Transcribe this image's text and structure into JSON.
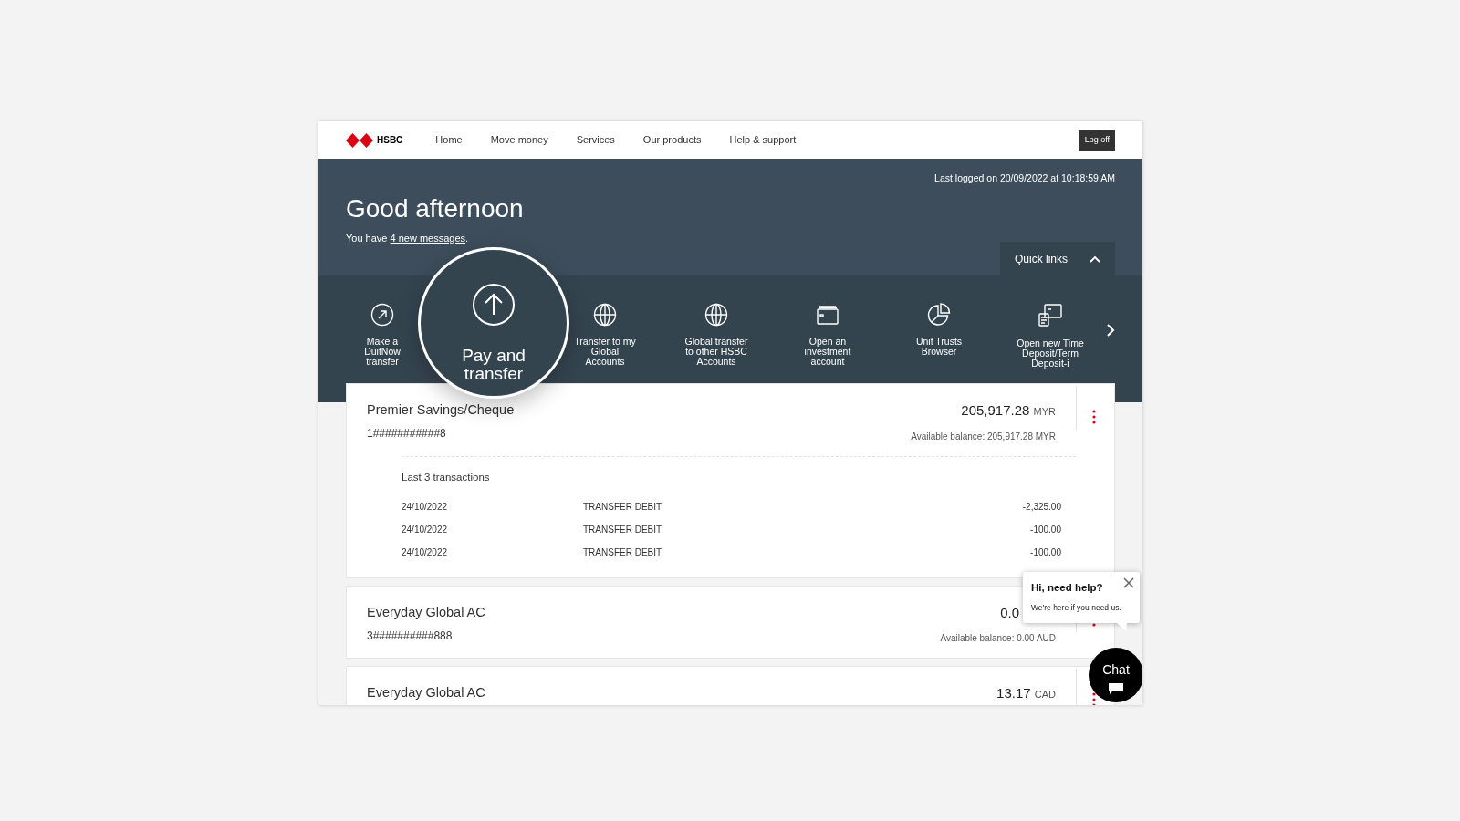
{
  "nav": {
    "brand": "HSBC",
    "links": [
      "Home",
      "Move money",
      "Services",
      "Our products",
      "Help & support"
    ],
    "logoff": "Log off"
  },
  "header": {
    "last_logged": "Last logged on 20/09/2022 at 10:18:59 AM",
    "greeting": "Good afternoon",
    "messages_prefix": "You have",
    "messages_link": "4 new messages",
    "messages_suffix": ".",
    "quick_links_toggle": {
      "label": "Quick links",
      "expanded": true
    }
  },
  "quick_links": [
    {
      "lines": [
        "Make a",
        "DuitNow",
        "transfer"
      ],
      "magnified": false
    },
    {
      "lines": [
        "Pay and",
        "transfer"
      ],
      "magnified": true
    },
    {
      "lines": [
        "Transfer to my",
        "Global",
        "Accounts"
      ],
      "magnified": false
    },
    {
      "lines": [
        "Global transfer",
        "to other HSBC",
        "Accounts"
      ],
      "magnified": false
    },
    {
      "lines": [
        "Open an",
        "investment",
        "account"
      ],
      "magnified": false
    },
    {
      "lines": [
        "Unit Trusts",
        "Browser"
      ],
      "magnified": false
    },
    {
      "lines": [
        "Open new Time",
        "Deposit/Term",
        "Deposit-i"
      ],
      "magnified": false
    }
  ],
  "accounts": [
    {
      "name": "Premier Savings/Cheque",
      "number": "1###########8",
      "amount": "205,917.28",
      "currency": "MYR",
      "available": "Available balance: 205,917.28 MYR",
      "transactions_title": "Last 3 transactions",
      "transactions": [
        {
          "date": "24/10/2022",
          "description": "TRANSFER DEBIT",
          "amount": "-2,325.00"
        },
        {
          "date": "24/10/2022",
          "description": "TRANSFER DEBIT",
          "amount": "-100.00"
        },
        {
          "date": "24/10/2022",
          "description": "TRANSFER DEBIT",
          "amount": "-100.00"
        }
      ]
    },
    {
      "name": "Everyday Global AC",
      "number": "3##########888",
      "amount": "0.0",
      "available": "Available balance: 0.00 AUD"
    },
    {
      "name": "Everyday Global AC",
      "amount": "13.17",
      "currency": "CAD"
    }
  ],
  "chat": {
    "popup_title": "Hi, need help?",
    "popup_text": "We're here if you need us.",
    "button": "Chat"
  }
}
